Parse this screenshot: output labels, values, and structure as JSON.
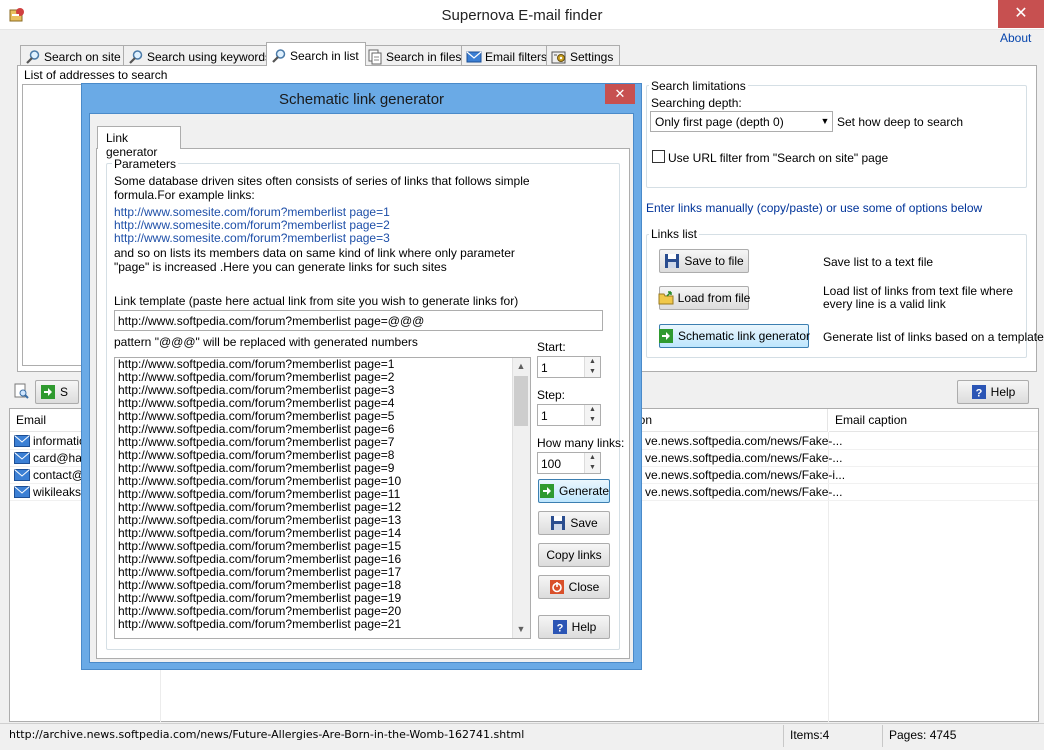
{
  "window": {
    "title": "Supernova E-mail finder",
    "about": "About",
    "close_glyph": "✕"
  },
  "tabs": [
    {
      "label": "Search on site",
      "icon": "magnifier-icon"
    },
    {
      "label": "Search using keywords",
      "icon": "magnifier-icon"
    },
    {
      "label": "Search in list",
      "icon": "magnifier-icon",
      "active": true
    },
    {
      "label": "Search in files",
      "icon": "files-icon"
    },
    {
      "label": "Email filters",
      "icon": "envelope-icon"
    },
    {
      "label": "Settings",
      "icon": "settings-icon"
    }
  ],
  "list_panel": {
    "label": "List of addresses to search"
  },
  "search_limitations": {
    "title": "Search limitations",
    "depth_label": "Searching depth:",
    "depth_value": "Only first page (depth 0)",
    "depth_hint": "Set how deep to search",
    "url_filter_label": "Use URL filter from \"Search on site\" page",
    "url_filter_checked": false
  },
  "manual_hint": "Enter links manually (copy/paste) or use some of options below",
  "links_list": {
    "title": "Links list",
    "save_label": "Save to file",
    "save_desc": "Save list to a text file",
    "load_label": "Load from file",
    "load_desc": "Load list of links from text file where every line is a valid link",
    "schematic_label": "Schematic link generator",
    "schematic_desc": "Generate list of links based on a template"
  },
  "toolbar": {
    "start_label": "S",
    "help_label": "Help"
  },
  "results": {
    "columns": [
      "Email",
      "ion",
      "Email caption"
    ],
    "rows": [
      {
        "email": "information",
        "location": "ve.news.softpedia.com/news/Fake-..."
      },
      {
        "email": "card@hall",
        "location": "ve.news.softpedia.com/news/Fake-..."
      },
      {
        "email": "contact@i",
        "location": "ve.news.softpedia.com/news/Fake-i..."
      },
      {
        "email": "wikileaks@",
        "location": "ve.news.softpedia.com/news/Fake-..."
      }
    ]
  },
  "status": {
    "url": "http://archive.news.softpedia.com/news/Future-Allergies-Are-Born-in-the-Womb-162741.shtml",
    "items": "Items:4",
    "pages": "Pages: 4745"
  },
  "dialog": {
    "title": "Schematic link generator",
    "close_glyph": "✕",
    "tab": "Link generator",
    "params_title": "Parameters",
    "description": "Some database driven sites often consists of series of links that follows simple formula.For example links:",
    "examples": [
      "http://www.somesite.com/forum?memberlist page=1",
      "http://www.somesite.com/forum?memberlist page=2",
      "http://www.somesite.com/forum?memberlist page=3"
    ],
    "after_text": "and so on lists its members data on same kind of link where only parameter \"page\" is increased .Here you can generate links for such sites",
    "template_label": "Link template (paste here actual link from site you wish to generate links for)",
    "template_value": "http://www.softpedia.com/forum?memberlist page=@@@",
    "pattern_note": "pattern \"@@@\" will be replaced with generated numbers",
    "start_label": "Start:",
    "start_value": "1",
    "step_label": "Step:",
    "step_value": "1",
    "count_label": "How many links:",
    "count_value": "100",
    "generate_label": "Generate",
    "save_label": "Save",
    "copy_label": "Copy links",
    "close_label": "Close",
    "help_label": "Help",
    "generated_links": [
      "http://www.softpedia.com/forum?memberlist page=1",
      "http://www.softpedia.com/forum?memberlist page=2",
      "http://www.softpedia.com/forum?memberlist page=3",
      "http://www.softpedia.com/forum?memberlist page=4",
      "http://www.softpedia.com/forum?memberlist page=5",
      "http://www.softpedia.com/forum?memberlist page=6",
      "http://www.softpedia.com/forum?memberlist page=7",
      "http://www.softpedia.com/forum?memberlist page=8",
      "http://www.softpedia.com/forum?memberlist page=9",
      "http://www.softpedia.com/forum?memberlist page=10",
      "http://www.softpedia.com/forum?memberlist page=11",
      "http://www.softpedia.com/forum?memberlist page=12",
      "http://www.softpedia.com/forum?memberlist page=13",
      "http://www.softpedia.com/forum?memberlist page=14",
      "http://www.softpedia.com/forum?memberlist page=15",
      "http://www.softpedia.com/forum?memberlist page=16",
      "http://www.softpedia.com/forum?memberlist page=17",
      "http://www.softpedia.com/forum?memberlist page=18",
      "http://www.softpedia.com/forum?memberlist page=19",
      "http://www.softpedia.com/forum?memberlist page=20",
      "http://www.softpedia.com/forum?memberlist page=21"
    ]
  },
  "colors": {
    "dialog_frame": "#6aaae6",
    "close_red": "#c75050",
    "link_blue": "#1e4fa8",
    "hint_blue": "#003399"
  }
}
